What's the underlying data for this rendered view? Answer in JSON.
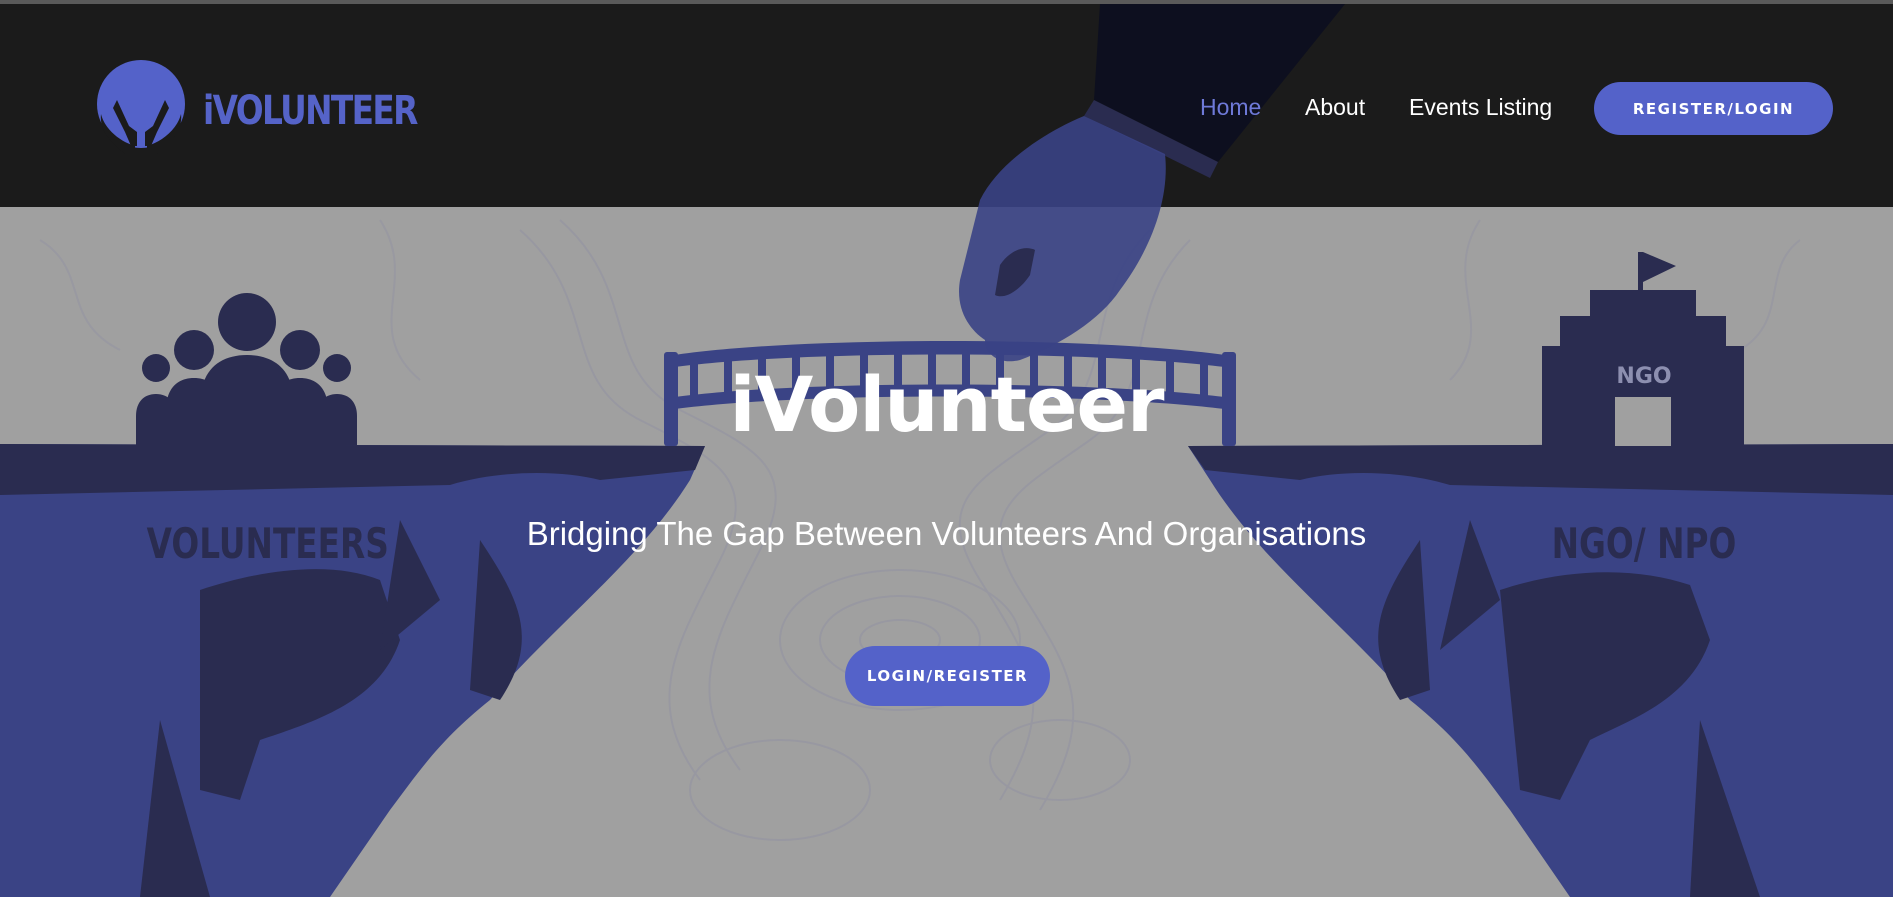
{
  "brand": {
    "name": "iVOLUNTEER",
    "accent": "#5462c9",
    "dark": "#1b1b1b"
  },
  "nav": {
    "items": [
      {
        "label": "Home",
        "active": true
      },
      {
        "label": "About",
        "active": false
      },
      {
        "label": "Events Listing",
        "active": false
      }
    ],
    "cta_label": "REGISTER/LOGIN"
  },
  "hero": {
    "title": "iVolunteer",
    "subtitle": "Bridging The Gap Between Volunteers And Organisations",
    "cta_label": "LOGIN/REGISTER",
    "left_label": "VOLUNTEERS",
    "right_label": "NGO/ NPO",
    "building_label": "NGO"
  },
  "icons": {
    "logo": "hands-holding-circle-icon",
    "volunteers": "people-group-icon",
    "ngo": "building-flag-icon",
    "bridge": "bridge-icon",
    "hand": "hand-placing-bridge-icon"
  }
}
